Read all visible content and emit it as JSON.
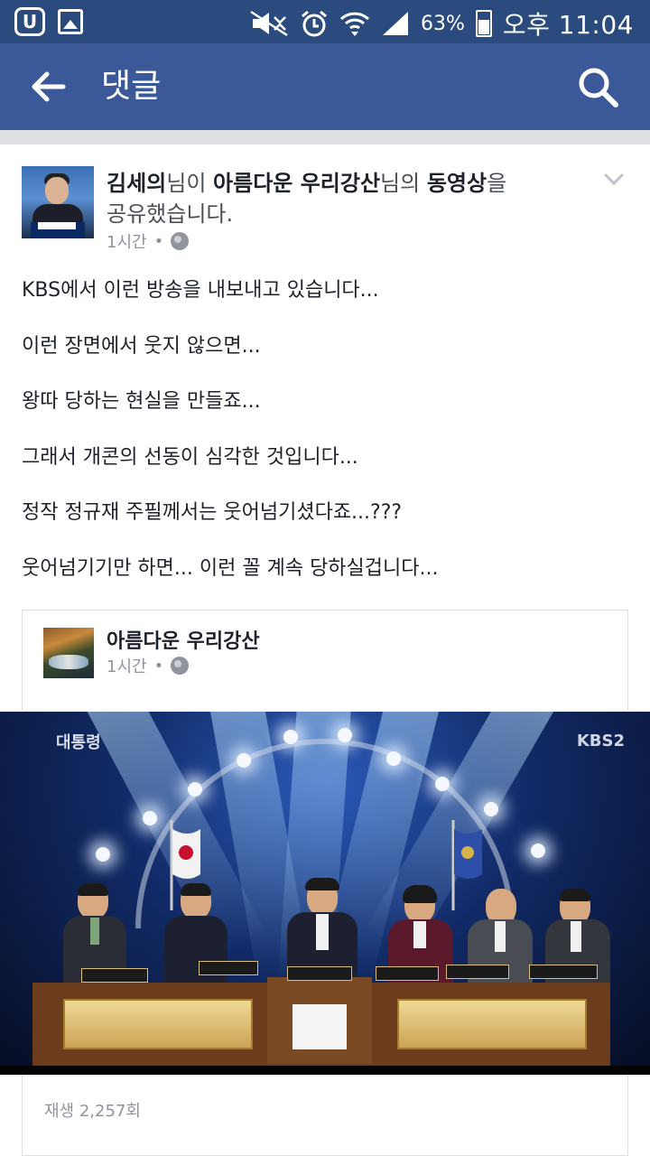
{
  "status_bar": {
    "left_icons": [
      "u-plus-icon",
      "image-icon"
    ],
    "right_icons": [
      "mute-icon",
      "alarm-icon",
      "wifi-icon",
      "signal-icon",
      "battery-charging-icon"
    ],
    "battery": "63%",
    "time": "오후 11:04"
  },
  "app_bar": {
    "title": "댓글",
    "back_icon": "back-arrow-icon",
    "search_icon": "search-icon",
    "background": "#3b5998"
  },
  "post": {
    "author": "김세의",
    "conj1": "님이 ",
    "page": "아름다운 우리강산",
    "conj2": "님의 ",
    "object": "동영상",
    "conj3": "을",
    "line2": "공유했습니다.",
    "time": "1시간",
    "separator": "•",
    "privacy_icon": "globe-icon",
    "menu_icon": "chevron-down-icon",
    "lines": [
      "KBS에서 이런 방송을 내보내고 있습니다...",
      "이런 장면에서 웃지 않으면...",
      "왕따 당하는 현실을 만들죠...",
      "그래서 개콘의 선동이 심각한 것입니다...",
      "정작 정규재 주필께서는 웃어넘기셨다죠...???",
      "웃어넘기기만 하면... 이런 꼴 계속 당하실겁니다..."
    ]
  },
  "shared": {
    "name": "아름다운 우리강산",
    "time": "1시간",
    "separator": "•",
    "privacy_icon": "globe-icon"
  },
  "video": {
    "logo_left": "대통령",
    "logo_right": "KBS2"
  },
  "plays": "재생 2,257회"
}
